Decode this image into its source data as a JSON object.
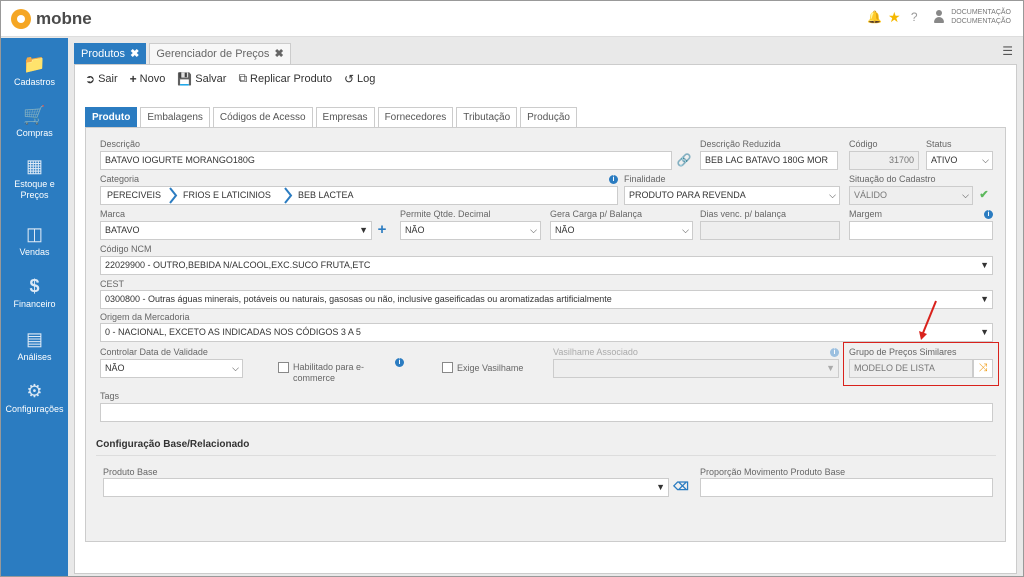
{
  "app": {
    "name": "mobne"
  },
  "user": {
    "name": "DOCUMENTAÇÃO",
    "subtitle": "DOCUMENTAÇÃO"
  },
  "sidebar": {
    "items": [
      {
        "label": "Cadastros",
        "icon": "folder-icon"
      },
      {
        "label": "Compras",
        "icon": "cart-icon"
      },
      {
        "label": "Estoque e Preços",
        "icon": "boxes-icon"
      },
      {
        "label": "Vendas",
        "icon": "basket-icon"
      },
      {
        "label": "Financeiro",
        "icon": "dollar-icon"
      },
      {
        "label": "Análises",
        "icon": "chart-icon"
      },
      {
        "label": "Configurações",
        "icon": "gears-icon"
      }
    ]
  },
  "tabs": [
    {
      "label": "Produtos"
    },
    {
      "label": "Gerenciador de Preços"
    }
  ],
  "toolbar": {
    "sair": "Sair",
    "novo": "Novo",
    "salvar": "Salvar",
    "replicar": "Replicar Produto",
    "log": "Log"
  },
  "form_tabs": [
    "Produto",
    "Embalagens",
    "Códigos de Acesso",
    "Empresas",
    "Fornecedores",
    "Tributação",
    "Produção"
  ],
  "fields": {
    "descricao": {
      "label": "Descrição",
      "value": "BATAVO IOGURTE  MORANGO180G"
    },
    "descricao_reduzida": {
      "label": "Descrição Reduzida",
      "value": "BEB LAC BATAVO 180G MOR"
    },
    "codigo": {
      "label": "Código",
      "value": "31700"
    },
    "status": {
      "label": "Status",
      "value": "ATIVO"
    },
    "categoria": {
      "label": "Categoria",
      "path": [
        "PERECIVEIS",
        "FRIOS E LATICINIOS",
        "BEB LACTEA"
      ]
    },
    "finalidade": {
      "label": "Finalidade",
      "value": "PRODUTO PARA REVENDA"
    },
    "situacao": {
      "label": "Situação do Cadastro",
      "value": "VÁLIDO"
    },
    "marca": {
      "label": "Marca",
      "value": "BATAVO"
    },
    "permite_qtde": {
      "label": "Permite Qtde. Decimal",
      "value": "NÃO"
    },
    "gera_carga": {
      "label": "Gera Carga p/ Balança",
      "value": "NÃO"
    },
    "dias_venc": {
      "label": "Dias venc. p/ balança",
      "value": ""
    },
    "margem": {
      "label": "Margem",
      "value": ""
    },
    "ncm": {
      "label": "Código NCM",
      "value": "22029900 - OUTRO,BEBIDA N/ALCOOL,EXC.SUCO FRUTA,ETC"
    },
    "cest": {
      "label": "CEST",
      "value": "0300800 - Outras águas minerais, potáveis ou naturais, gasosas ou não, inclusive gaseificadas ou aromatizadas artificialmente"
    },
    "origem": {
      "label": "Origem da Mercadoria",
      "value": "0 - NACIONAL, EXCETO AS INDICADAS NOS CÓDIGOS 3 A 5"
    },
    "controlar_data": {
      "label": "Controlar Data de Validade",
      "value": "NÃO"
    },
    "habilitado_ecom": {
      "label_line1": "Habilitado para e-",
      "label_line2": "commerce",
      "checked": false
    },
    "exige_vasilhame": {
      "label": "Exige Vasilhame",
      "checked": false
    },
    "vasilhame": {
      "label": "Vasilhame Associado",
      "value": ""
    },
    "grupo_precos": {
      "label": "Grupo de Preços Similares",
      "value": "MODELO DE LISTA"
    },
    "tags": {
      "label": "Tags",
      "value": ""
    }
  },
  "config": {
    "title": "Configuração Base/Relacionado",
    "produto_base": {
      "label": "Produto Base",
      "value": ""
    },
    "proporcao": {
      "label": "Proporção Movimento Produto Base",
      "value": ""
    }
  },
  "colors": {
    "accent": "#2b7cc1",
    "highlight": "#d9221c",
    "logo": "#f5a623"
  }
}
